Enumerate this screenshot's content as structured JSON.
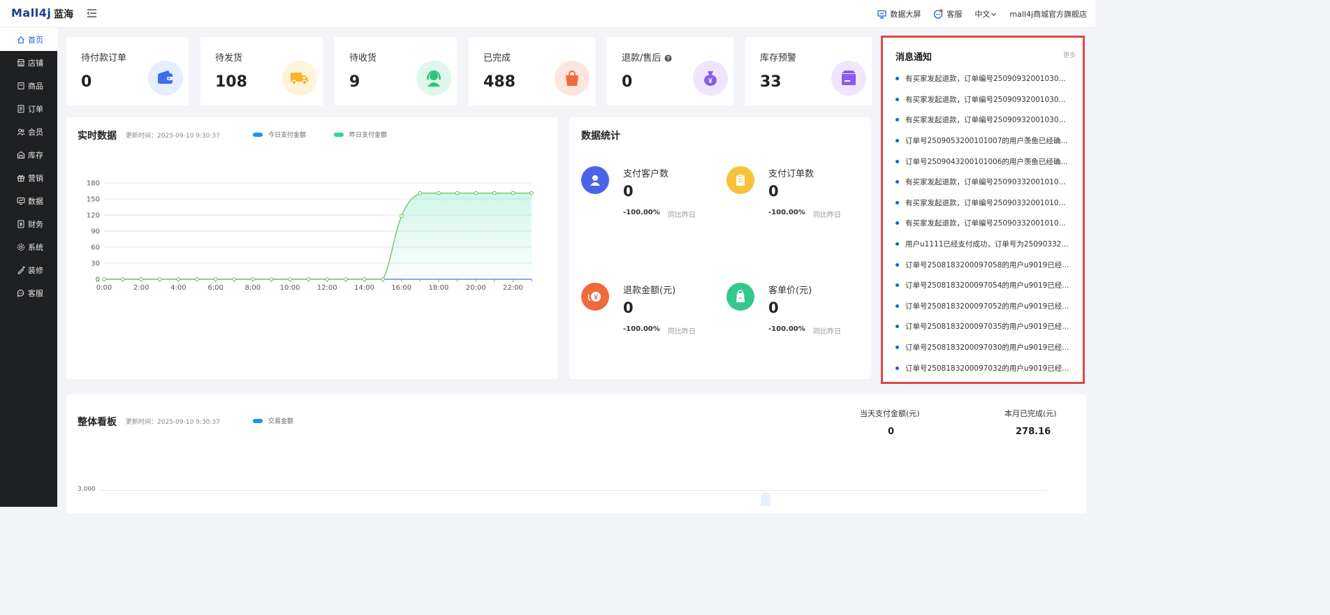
{
  "header": {
    "logo": "Mall4j",
    "logo_sub": "蓝海",
    "big_screen": "数据大屏",
    "customer_service": "客服",
    "language": "中文",
    "store_name": "mall4j商城官方旗舰店"
  },
  "sidebar": {
    "items": [
      {
        "label": "首页",
        "icon": "home-icon",
        "active": true
      },
      {
        "label": "店铺",
        "icon": "shop-icon"
      },
      {
        "label": "商品",
        "icon": "goods-icon"
      },
      {
        "label": "订单",
        "icon": "order-icon"
      },
      {
        "label": "会员",
        "icon": "member-icon"
      },
      {
        "label": "库存",
        "icon": "stock-icon"
      },
      {
        "label": "营销",
        "icon": "gift-icon"
      },
      {
        "label": "数据",
        "icon": "data-icon"
      },
      {
        "label": "财务",
        "icon": "finance-icon"
      },
      {
        "label": "系统",
        "icon": "settings-icon"
      },
      {
        "label": "装修",
        "icon": "decorate-icon"
      },
      {
        "label": "客服",
        "icon": "chat-icon"
      }
    ]
  },
  "stats": [
    {
      "label": "待付款订单",
      "value": "0",
      "icon": "wallet-icon",
      "color": "#3a6df0",
      "bg": "#e5edff"
    },
    {
      "label": "待发货",
      "value": "108",
      "icon": "truck-icon",
      "color": "#f5b42a",
      "bg": "#fff3d9"
    },
    {
      "label": "待收货",
      "value": "9",
      "icon": "headset-icon",
      "color": "#2cc47a",
      "bg": "#def7ea"
    },
    {
      "label": "已完成",
      "value": "488",
      "icon": "bag-icon",
      "color": "#f06a3c",
      "bg": "#fde6de"
    },
    {
      "label": "退款/售后",
      "value": "0",
      "icon": "money-bag-icon",
      "color": "#8a5cf0",
      "bg": "#efe6fd"
    },
    {
      "label": "库存预警",
      "value": "33",
      "icon": "box-icon",
      "color": "#8a5cf0",
      "bg": "#efe6fd"
    }
  ],
  "realtime": {
    "title": "实时数据",
    "update_label": "更新时间：2025-09-10   9:30:37",
    "legend_today": "今日支付金额",
    "legend_yesterday": "昨日支付金额"
  },
  "chart_data": {
    "type": "area",
    "title": "实时数据",
    "x": [
      "0:00",
      "1:00",
      "2:00",
      "3:00",
      "4:00",
      "5:00",
      "6:00",
      "7:00",
      "8:00",
      "9:00",
      "10:00",
      "11:00",
      "12:00",
      "13:00",
      "14:00",
      "15:00",
      "16:00",
      "17:00",
      "18:00",
      "19:00",
      "20:00",
      "21:00",
      "22:00",
      "23:00"
    ],
    "x_tick_labels": [
      "0:00",
      "2:00",
      "4:00",
      "6:00",
      "8:00",
      "10:00",
      "12:00",
      "14:00",
      "16:00",
      "18:00",
      "20:00",
      "22:00"
    ],
    "series": [
      {
        "name": "今日支付金额",
        "color": "#1e90f0",
        "values": [
          0,
          0,
          0,
          0,
          0,
          0,
          0,
          0,
          0,
          0,
          0,
          0,
          0,
          0,
          0,
          0,
          0,
          0,
          0,
          0,
          0,
          0,
          0,
          0
        ]
      },
      {
        "name": "昨日支付金额",
        "color": "#2dd4a0",
        "values": [
          0,
          0,
          0,
          0,
          0,
          0,
          0,
          0,
          0,
          0,
          0,
          0,
          0,
          0,
          0,
          0,
          118,
          161,
          161,
          161,
          161,
          161,
          161,
          161
        ]
      }
    ],
    "ylim": [
      0,
      180
    ],
    "y_ticks": [
      0,
      30,
      60,
      90,
      120,
      150,
      180
    ],
    "grid": true,
    "legend": "top"
  },
  "stats_panel": {
    "title": "数据统计",
    "items": [
      {
        "label": "支付客户数",
        "value": "0",
        "pct": "-100.00%",
        "cmp": "同比昨日",
        "icon": "user-icon",
        "color": "#4a63e8"
      },
      {
        "label": "支付订单数",
        "value": "0",
        "pct": "-100.00%",
        "cmp": "同比昨日",
        "icon": "clipboard-icon",
        "color": "#f7c23a"
      },
      {
        "label": "退款金额(元)",
        "value": "0",
        "pct": "-100.00%",
        "cmp": "同比昨日",
        "icon": "refund-icon",
        "color": "#f06a3c"
      },
      {
        "label": "客单价(元)",
        "value": "0",
        "pct": "-100.00%",
        "cmp": "同比昨日",
        "icon": "price-tag-icon",
        "color": "#34c98a"
      }
    ]
  },
  "notice": {
    "title": "消息通知",
    "more": "更多",
    "items": [
      "有买家发起退款，订单编号25090932001030...",
      "有买家发起退款，订单编号25090932001030...",
      "有买家发起退款，订单编号25090932001030...",
      "订单号2509053200101007的用户羡鱼已经确...",
      "订单号2509043200101006的用户羡鱼已经确...",
      "有买家发起退款，订单编号25090332001010...",
      "有买家发起退款，订单编号25090332001010...",
      "有买家发起退款，订单编号25090332001010...",
      "用户u1111已经支付成功，订单号为25090332...",
      "订单号2508183200097058的用户u9019已经...",
      "订单号2508183200097054的用户u9019已经...",
      "订单号2508183200097052的用户u9019已经...",
      "订单号2508183200097035的用户u9019已经...",
      "订单号2508183200097030的用户u9019已经...",
      "订单号2508183200097032的用户u9019已经..."
    ]
  },
  "board": {
    "title": "整体看板",
    "update_label": "更新时间：2025-09-10   9:30:37",
    "legend": "交易金额",
    "y_tick": "3,000",
    "today_label": "当天支付金额(元)",
    "today_value": "0",
    "month_label": "本月已完成(元)",
    "month_value": "278.16"
  }
}
